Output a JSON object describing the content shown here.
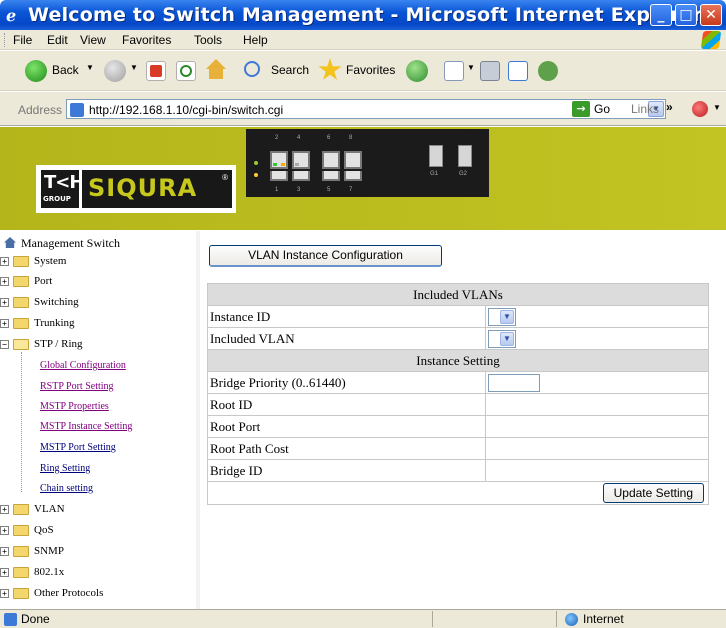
{
  "window": {
    "title": "Welcome to Switch Management - Microsoft Internet Explorer",
    "controls": {
      "minimize": "_",
      "maximize": "□",
      "close": "✕"
    }
  },
  "menu": {
    "items": [
      "File",
      "Edit",
      "View",
      "Favorites",
      "Tools",
      "Help"
    ]
  },
  "toolbar": {
    "back_label": "Back",
    "search_label": "Search",
    "favorites_label": "Favorites"
  },
  "address": {
    "label": "Address",
    "url": "http://192.168.1.10/cgi-bin/switch.cgi",
    "go_label": "Go",
    "links_label": "Links",
    "links_chevron": "»"
  },
  "brand": {
    "group_letters": "T<H",
    "group_label": "GROUP",
    "name": "SIQURA",
    "mark": "®"
  },
  "switch_panel": {
    "top_port_numbers": [
      "2",
      "4",
      "6",
      "8"
    ],
    "bottom_port_numbers": [
      "1",
      "3",
      "5",
      "7"
    ],
    "sfp_labels": [
      "G1",
      "G2"
    ]
  },
  "sidebar": {
    "root": "Management Switch",
    "folders_top": [
      "System",
      "Port",
      "Switching",
      "Trunking"
    ],
    "stp_folder": "STP / Ring",
    "stp_items": [
      {
        "label": "Global Configuration",
        "visited": true
      },
      {
        "label": "RSTP Port Setting",
        "visited": true
      },
      {
        "label": "MSTP Properties",
        "visited": true
      },
      {
        "label": "MSTP Instance Setting",
        "visited": true
      },
      {
        "label": "MSTP Port Setting",
        "visited": false
      },
      {
        "label": "Ring Setting",
        "visited": false
      },
      {
        "label": "Chain setting",
        "visited": false
      }
    ],
    "folders_bottom": [
      "VLAN",
      "QoS",
      "SNMP",
      "802.1x",
      "Other Protocols"
    ],
    "expand_symbol": "+",
    "collapse_symbol": "−"
  },
  "main": {
    "tab_button": "VLAN Instance Configuration",
    "included_header": "Included VLANs",
    "instance_id_label": "Instance ID",
    "instance_id_value": "",
    "included_vlan_label": "Included VLAN",
    "included_vlan_value": "",
    "instance_setting_header": "Instance Setting",
    "bridge_priority_label": "Bridge Priority (0..61440)",
    "bridge_priority_value": "",
    "root_id_label": "Root ID",
    "root_id_value": "",
    "root_port_label": "Root Port",
    "root_port_value": "",
    "root_path_cost_label": "Root Path Cost",
    "root_path_cost_value": "",
    "bridge_id_label": "Bridge ID",
    "bridge_id_value": "",
    "update_button": "Update Setting"
  },
  "status": {
    "text": "Done",
    "zone": "Internet"
  },
  "colors": {
    "banner": "#b8ba16",
    "titlebar": "#0a56d6",
    "brand_text": "#c6c81c"
  }
}
